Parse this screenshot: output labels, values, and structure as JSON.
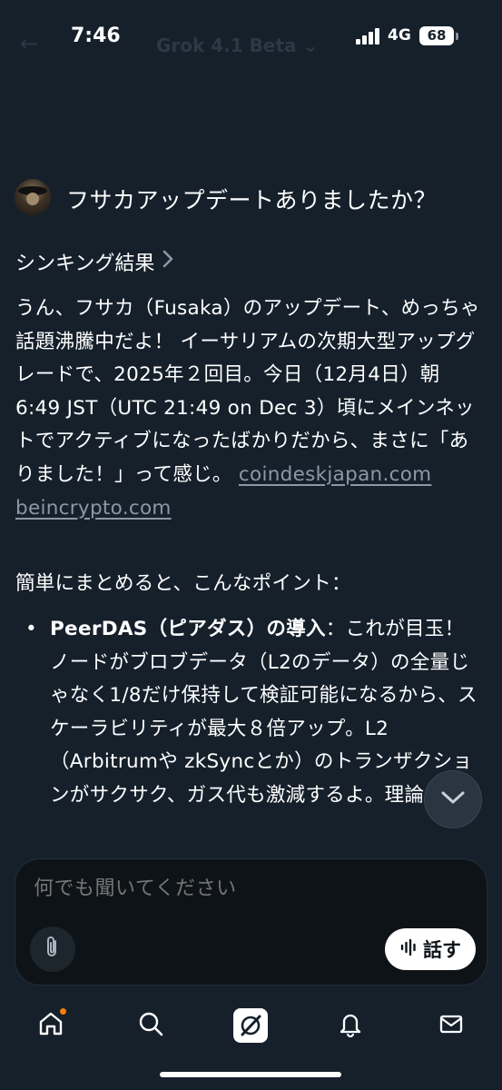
{
  "status_bar": {
    "time": "7:46",
    "network": "4G",
    "battery": "68",
    "header_ghost_title": "Grok 4.1 Beta ⌄",
    "header_ghost_back": "←"
  },
  "conversation": {
    "question": "フサカアップデートありましたか？",
    "thinking_label": "シンキング結果",
    "answer_paragraph": "うん、フサカ（Fusaka）のアップデート、めっちゃ話題沸騰中だよ！ イーサリアムの次期大型アップグレードで、2025年２回目。今日（12月4日）朝6:49 JST（UTC 21:49 on Dec 3）頃にメインネットでアクティブになったばかりだから、まさに「ありました！」って感じ。",
    "sources": [
      "coindeskjapan.com",
      "beincrypto.com"
    ],
    "summary_intro": "簡単にまとめると、こんなポイント：",
    "bullet": {
      "title": "PeerDAS（ピアダス）の導入",
      "text": "：これが目玉！ ノードがブロブデータ（L2のデータ）の全量じゃなく1/8だけ保持して検証可能になるから、スケーラビリティが最大８倍アップ。L2（Arbitrumや zkSyncとか）のトランザクションがサクサク、ガス代も激減するよ。理論"
    }
  },
  "composer": {
    "placeholder": "何でも聞いてください",
    "speak_label": "話す"
  },
  "icons": {
    "attach": "paperclip-icon",
    "speak": "waveform-icon",
    "scroll": "chevron-down-icon",
    "nav": [
      "home-icon",
      "search-icon",
      "grok-icon",
      "bell-icon",
      "mail-icon"
    ]
  },
  "colors": {
    "background": "#15202b",
    "composer_bg": "#0e1318",
    "link_gray": "#8b98a5",
    "notification_dot": "#f4800a"
  }
}
